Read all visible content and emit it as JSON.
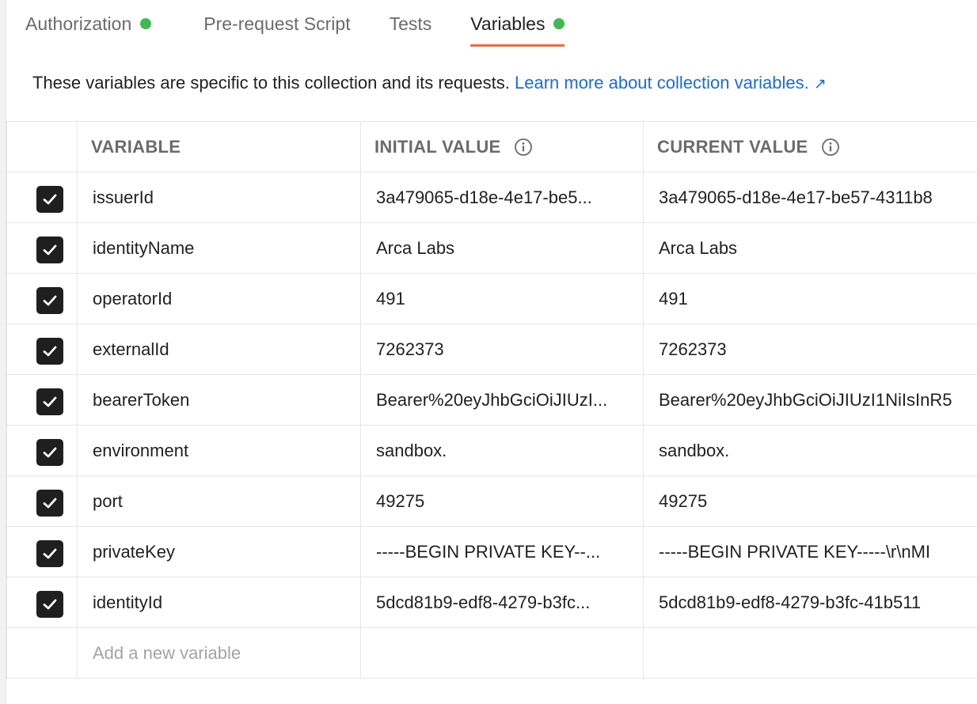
{
  "tabs": [
    {
      "label": "Authorization",
      "has_dot": true,
      "active": false
    },
    {
      "label": "Pre-request Script",
      "has_dot": false,
      "active": false
    },
    {
      "label": "Tests",
      "has_dot": false,
      "active": false
    },
    {
      "label": "Variables",
      "has_dot": true,
      "active": true
    }
  ],
  "colors": {
    "dot": "#3fb950",
    "active_underline": "#ef6c3a",
    "link": "#1e6ad9",
    "checkbox": "#1f1f1f"
  },
  "description": {
    "text": "These variables are specific to this collection and its requests.",
    "link_text": "Learn more about collection variables.",
    "link_icon": "external-link-arrow-icon",
    "link_arrow": "↗"
  },
  "table": {
    "headers": {
      "variable": "VARIABLE",
      "initial_value": "INITIAL VALUE",
      "current_value": "CURRENT VALUE",
      "info_icon": "info-icon"
    },
    "rows": [
      {
        "checked": true,
        "name": "issuerId",
        "initial": "3a479065-d18e-4e17-be5...",
        "current": "3a479065-d18e-4e17-be57-4311b8"
      },
      {
        "checked": true,
        "name": "identityName",
        "initial": "Arca Labs",
        "current": "Arca Labs"
      },
      {
        "checked": true,
        "name": "operatorId",
        "initial": "491",
        "current": "491"
      },
      {
        "checked": true,
        "name": "externalId",
        "initial": "7262373",
        "current": "7262373"
      },
      {
        "checked": true,
        "name": "bearerToken",
        "initial": "Bearer%20eyJhbGciOiJIUzI...",
        "current": "Bearer%20eyJhbGciOiJIUzI1NiIsInR5"
      },
      {
        "checked": true,
        "name": "environment",
        "initial": "sandbox.",
        "current": "sandbox."
      },
      {
        "checked": true,
        "name": "port",
        "initial": "49275",
        "current": "49275"
      },
      {
        "checked": true,
        "name": "privateKey",
        "initial": "-----BEGIN PRIVATE KEY--...",
        "current": "-----BEGIN PRIVATE KEY-----\\r\\nMI"
      },
      {
        "checked": true,
        "name": "identityId",
        "initial": "5dcd81b9-edf8-4279-b3fc...",
        "current": "5dcd81b9-edf8-4279-b3fc-41b511"
      }
    ],
    "new_row_placeholder": "Add a new variable"
  }
}
